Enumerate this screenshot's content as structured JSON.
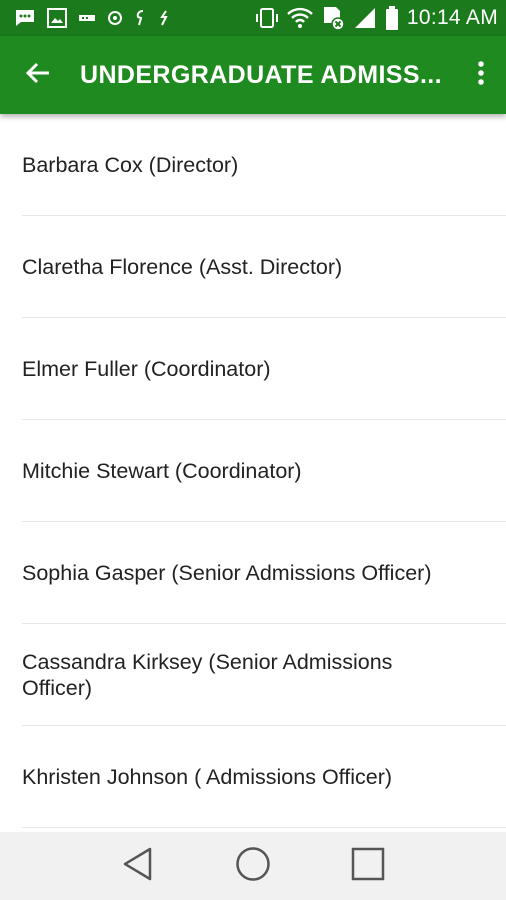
{
  "status_bar": {
    "time": "10:14 AM",
    "left_icons": [
      "message-icon",
      "image-icon",
      "notification-icon",
      "app-icon",
      "app-icon",
      "app-icon"
    ],
    "right_icons": [
      "vibrate-icon",
      "wifi-icon",
      "data-icon",
      "signal-icon",
      "battery-icon"
    ]
  },
  "app_bar": {
    "title": "UNDERGRADUATE ADMISS...",
    "back_icon": "arrow-back-icon",
    "overflow_icon": "more-vertical-icon",
    "color": "#1f8a1f"
  },
  "list": {
    "items": [
      {
        "label": "Barbara Cox (Director)"
      },
      {
        "label": "Claretha Florence (Asst. Director)"
      },
      {
        "label": "Elmer Fuller (Coordinator)"
      },
      {
        "label": "Mitchie Stewart (Coordinator)"
      },
      {
        "label": "Sophia Gasper (Senior Admissions Officer)"
      },
      {
        "label": "Cassandra Kirksey (Senior Admissions Officer)"
      },
      {
        "label": "Khristen Johnson ( Admissions Officer)"
      }
    ]
  },
  "nav_bar": {
    "back_icon": "nav-back-triangle-icon",
    "home_icon": "nav-home-circle-icon",
    "recents_icon": "nav-recents-square-icon"
  }
}
